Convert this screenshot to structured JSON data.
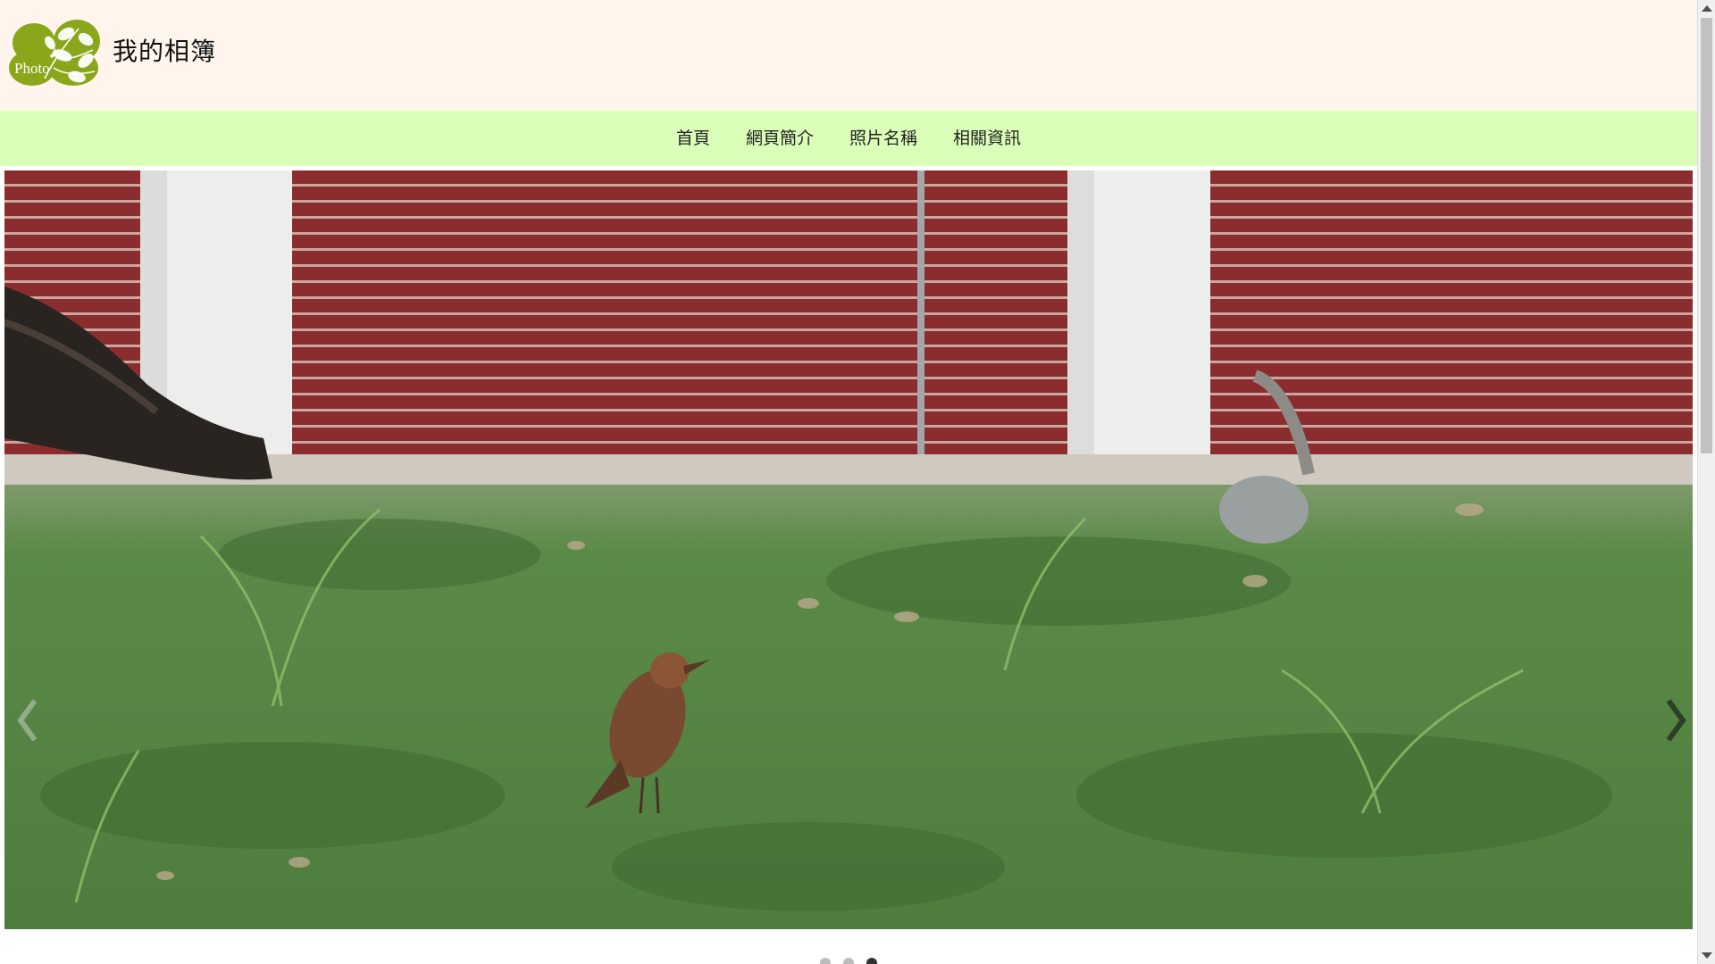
{
  "header": {
    "logo_text": "Photo",
    "title": "我的相簿"
  },
  "nav": {
    "items": [
      {
        "label": "首頁"
      },
      {
        "label": "網頁簡介"
      },
      {
        "label": "照片名稱"
      },
      {
        "label": "相關資訊"
      }
    ]
  },
  "carousel": {
    "slide_icon": "photo-icon",
    "prev_icon": "chevron-left-icon",
    "next_icon": "chevron-right-icon",
    "indicator_count": 3,
    "active_indicator": 3
  },
  "colors": {
    "header_bg": "#fff5ec",
    "nav_bg": "#dbffb8",
    "logo_green": "#8aa61a",
    "wall_red": "#8b2d2f",
    "grass_green": "#5e8d4a"
  }
}
